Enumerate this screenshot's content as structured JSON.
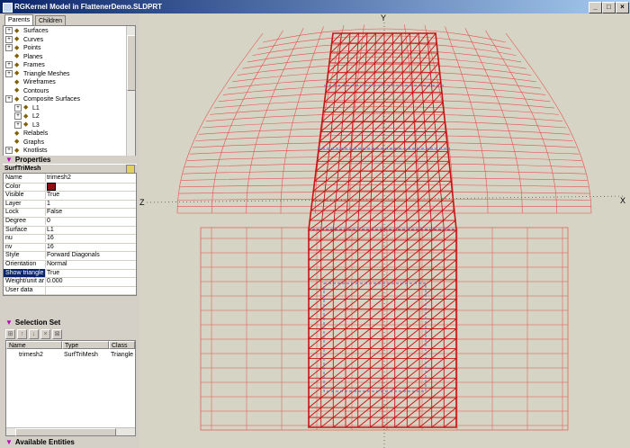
{
  "window": {
    "title": "RGKernel Model in FlattenerDemo.SLDPRT"
  },
  "tabs": [
    "Parents",
    "Children"
  ],
  "tree": [
    {
      "label": "Surfaces",
      "icon": "surfaces-icon"
    },
    {
      "label": "Curves",
      "icon": "curves-icon"
    },
    {
      "label": "Points",
      "icon": "points-icon"
    },
    {
      "label": "Planes",
      "icon": "planes-icon"
    },
    {
      "label": "Frames",
      "icon": "frames-icon"
    },
    {
      "label": "Triangle Meshes",
      "icon": "triangle-meshes-icon"
    },
    {
      "label": "Wireframes",
      "icon": "wireframes-icon"
    },
    {
      "label": "Contours",
      "icon": "contours-icon"
    },
    {
      "label": "Composite Surfaces",
      "icon": "composite-surfaces-icon"
    },
    {
      "label": "L1",
      "icon": "surface-icon"
    },
    {
      "label": "L2",
      "icon": "surface-icon"
    },
    {
      "label": "L3",
      "icon": "surface-icon"
    },
    {
      "label": "Relabels",
      "icon": "relabels-icon"
    },
    {
      "label": "Graphs",
      "icon": "graphs-icon"
    },
    {
      "label": "Knotlists",
      "icon": "knotlists-icon"
    }
  ],
  "properties": {
    "header": "Properties",
    "object_type": "SurfTriMesh",
    "rows": [
      {
        "name": "Name",
        "value": "trimesh2"
      },
      {
        "name": "Color",
        "value": ""
      },
      {
        "name": "Visible",
        "value": "True"
      },
      {
        "name": "Layer",
        "value": "1"
      },
      {
        "name": "Lock",
        "value": "False"
      },
      {
        "name": "Degree",
        "value": "0"
      },
      {
        "name": "Surface",
        "value": "L1"
      },
      {
        "name": "nu",
        "value": "16"
      },
      {
        "name": "nv",
        "value": "16"
      },
      {
        "name": "Style",
        "value": "Forward Diagonals"
      },
      {
        "name": "Orientation",
        "value": "Normal"
      },
      {
        "name": "Show triangle",
        "value": "True"
      },
      {
        "name": "Weight/unit ar",
        "value": "0.000"
      },
      {
        "name": "User data",
        "value": ""
      }
    ],
    "color_value": "#8b1010"
  },
  "selection_set": {
    "header": "Selection Set",
    "columns": [
      "Name",
      "Type",
      "Class"
    ],
    "rows": [
      {
        "name": "trimesh2",
        "type": "SurfTriMesh",
        "class": "Triangle"
      }
    ]
  },
  "available_entities": {
    "header": "Available Entities"
  },
  "viewport": {
    "axes": {
      "y": "Y",
      "z": "Z",
      "x": "X"
    },
    "mesh_color": "#c81414",
    "wire_color": "#e85050"
  }
}
